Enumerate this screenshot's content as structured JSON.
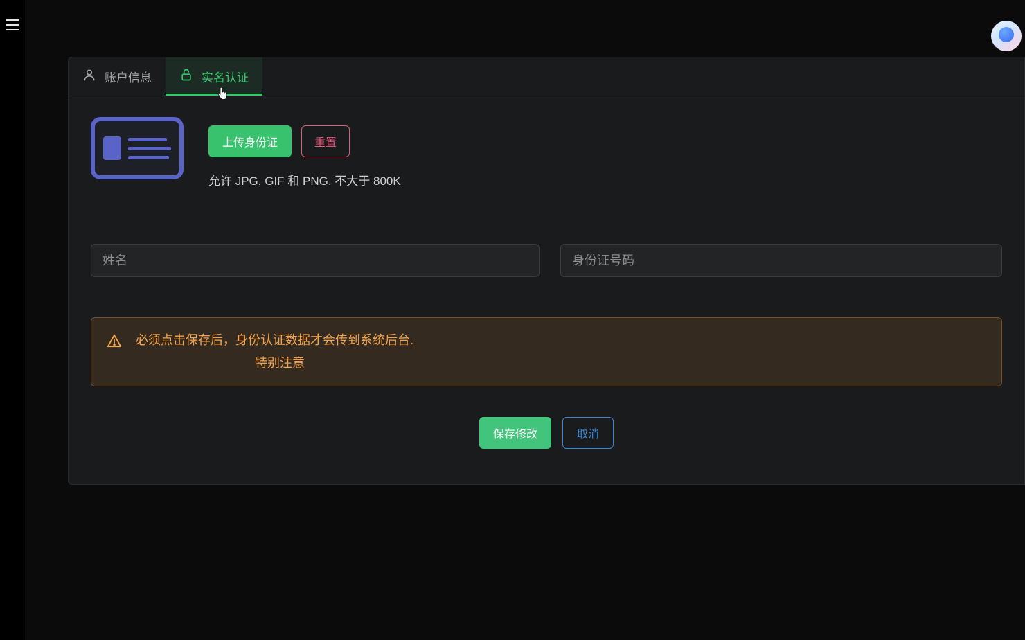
{
  "tabs": {
    "account_info": "账户信息",
    "realname_auth": "实名认证"
  },
  "upload": {
    "upload_button": "上传身份证",
    "reset_button": "重置",
    "hint": "允许 JPG, GIF 和 PNG. 不大于 800K"
  },
  "fields": {
    "name_placeholder": "姓名",
    "id_number_placeholder": "身份证号码"
  },
  "alert": {
    "message": "必须点击保存后，身份认证数据才会传到系统后台.",
    "subnote": "特别注意"
  },
  "footer": {
    "save": "保存修改",
    "cancel": "取消"
  },
  "icons": {
    "hamburger": "menu-icon",
    "person": "person-icon",
    "lock": "lock-open-icon",
    "warning": "warning-icon",
    "avatar": "avatar"
  }
}
